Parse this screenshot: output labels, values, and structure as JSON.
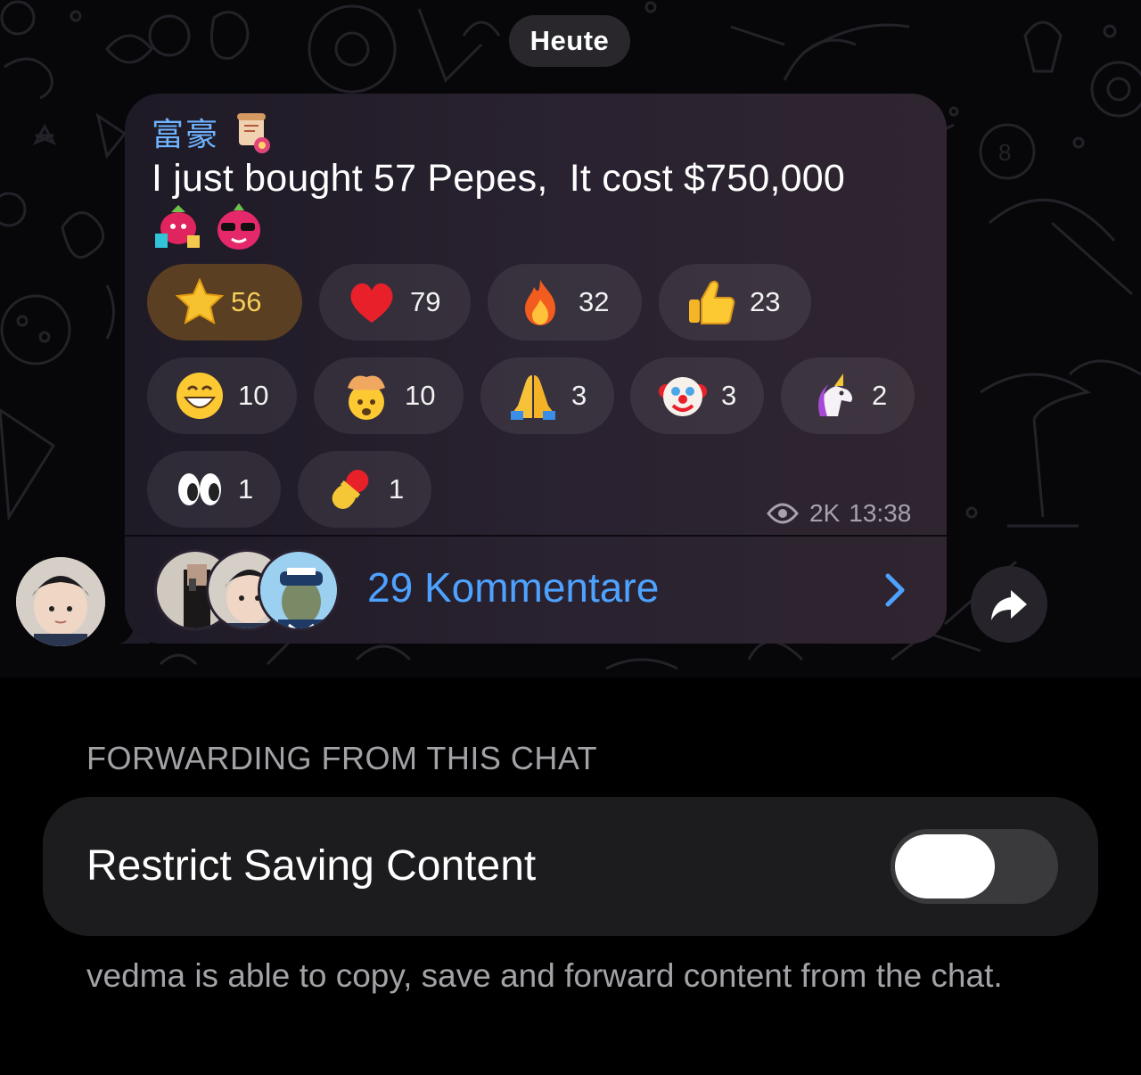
{
  "chat": {
    "date_label": "Heute",
    "message": {
      "author": "富豪",
      "text": "I just bought 57 Pepes,  It cost $750,000",
      "reactions": [
        {
          "emoji": "star",
          "count": "56"
        },
        {
          "emoji": "red-heart",
          "count": "79"
        },
        {
          "emoji": "fire",
          "count": "32"
        },
        {
          "emoji": "thumbs-up",
          "count": "23"
        },
        {
          "emoji": "grinning-face",
          "count": "10"
        },
        {
          "emoji": "exploding-head",
          "count": "10"
        },
        {
          "emoji": "folded-hands",
          "count": "3"
        },
        {
          "emoji": "clown-face",
          "count": "3"
        },
        {
          "emoji": "unicorn",
          "count": "2"
        },
        {
          "emoji": "eyes",
          "count": "1"
        },
        {
          "emoji": "pill",
          "count": "1"
        }
      ],
      "views": "2K",
      "time": "13:38",
      "comments_label": "29 Kommentare"
    }
  },
  "settings": {
    "section_header": "FORWARDING FROM THIS CHAT",
    "restrict_label": "Restrict Saving Content",
    "restrict_enabled": false,
    "footnote": "vedma is able to copy, save and forward content from the chat."
  },
  "colors": {
    "accent": "#4ea2ff",
    "author": "#6fb3ff",
    "star_count": "#f6cf58",
    "secondary_text": "#a2a2a7",
    "cell_background": "#1c1c1e"
  }
}
